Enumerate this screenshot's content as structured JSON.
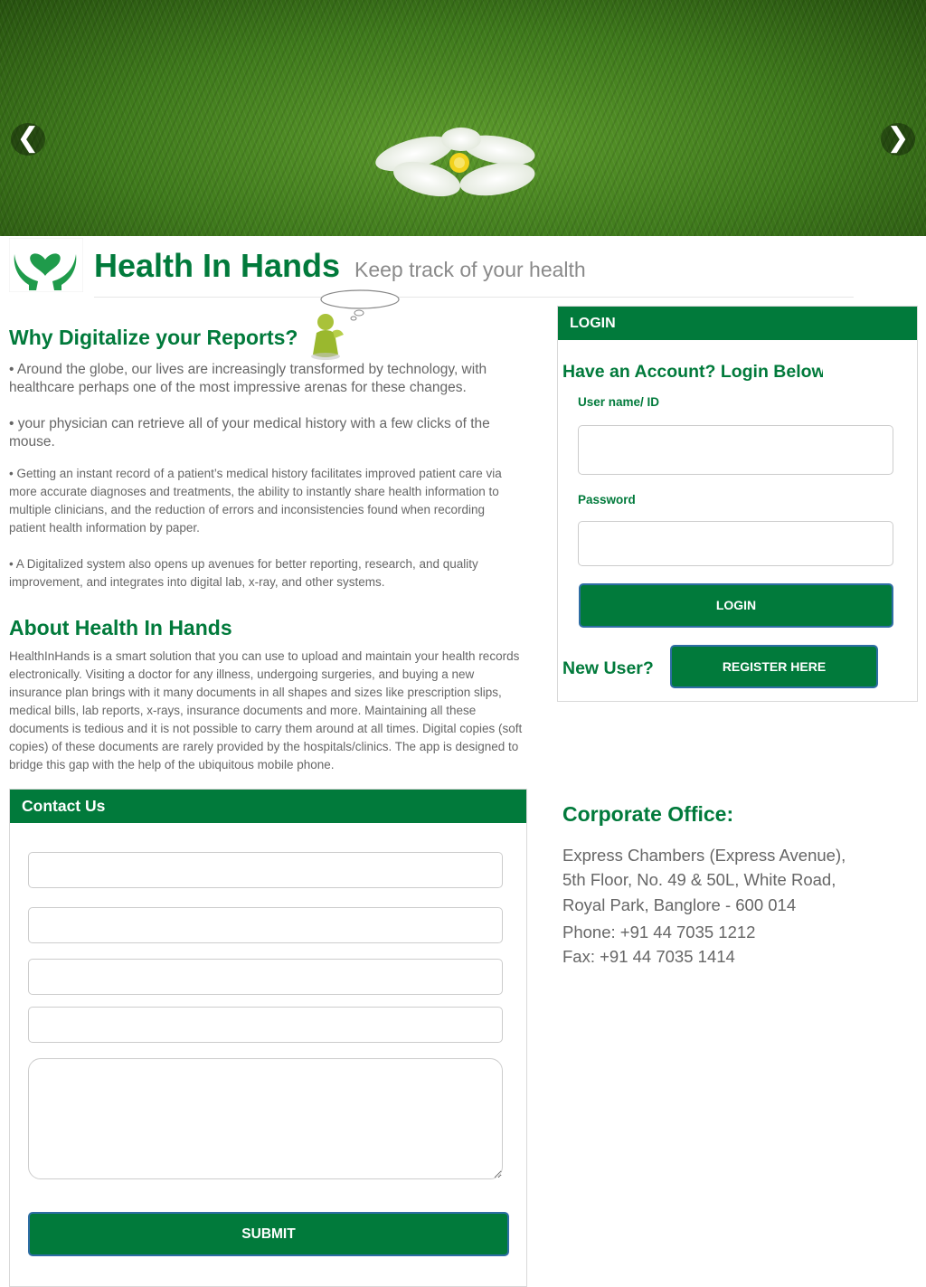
{
  "carousel": {
    "prev_label": "❮",
    "next_label": "❯"
  },
  "header": {
    "title": "Health In Hands",
    "tagline": "Keep track of your health"
  },
  "why": {
    "title": "Why Digitalize your Reports?",
    "points": [
      "• Around the globe, our lives are increasingly transformed by technology, with healthcare perhaps one of the most impressive arenas for these changes.",
      "• your physician can retrieve all of your medical history with a few clicks of the mouse.",
      "• Getting an instant record of a patient’s medical history facilitates improved patient care via more accurate diagnoses and treatments, the ability to instantly share health information to multiple clinicians, and the reduction of errors and inconsistencies found when recording patient health information by paper.",
      "• A Digitalized system also opens up avenues for better reporting, research, and quality improvement, and integrates into digital lab, x-ray, and other systems."
    ]
  },
  "about": {
    "title": "About Health In Hands",
    "text": "HealthInHands is a smart solution that you can use to upload and maintain your health records electronically. Visiting a doctor for any illness, undergoing surgeries, and buying a new insurance plan brings with it many documents in all shapes and sizes like prescription slips, medical bills, lab reports, x-rays, insurance documents and more. Maintaining all these documents is tedious and it is not possible to carry them around at all times. Digital copies (soft copies) of these documents are rarely provided by the hospitals/clinics. The app is designed to bridge this gap with the help of the ubiquitous mobile phone."
  },
  "login": {
    "heading": "LOGIN",
    "subtitle": "Have an Account? Login Below",
    "username_label": "User name/ ID",
    "password_label": "Password",
    "username_value": "",
    "password_value": "",
    "login_button": "LOGIN",
    "new_user_label": "New User?",
    "register_button": "REGISTER HERE"
  },
  "contact": {
    "heading": "Contact Us",
    "fields": [
      "",
      "",
      "",
      ""
    ],
    "message": "",
    "submit_button": "SUBMIT"
  },
  "office": {
    "title": "Corporate Office:",
    "lines": [
      "Express Chambers (Express Avenue),",
      "5th Floor, No. 49 & 50L, White Road,",
      "Royal Park, Banglore - 600 014"
    ],
    "phone": "Phone: +91 44 7035 1212",
    "fax": "Fax: +91 44 7035 1414"
  },
  "colors": {
    "brand_green": "#017a3b",
    "button_border": "#2e6da4",
    "body_text": "#666666"
  },
  "icons": {
    "logo": "heart-in-hands-icon",
    "mascot": "thinking-figure-icon",
    "banner": "flower-on-grass-image"
  }
}
